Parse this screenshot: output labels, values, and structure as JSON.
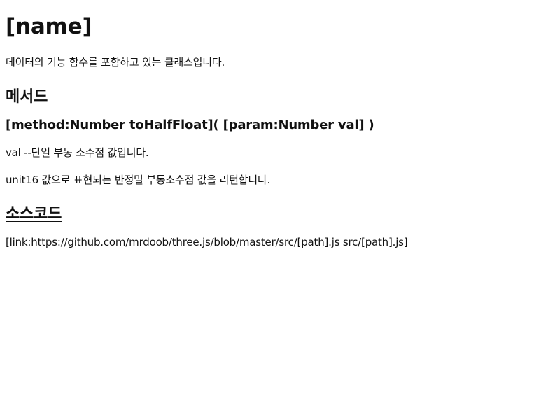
{
  "doc": {
    "title": "[name]",
    "description": "데이터의 기능 함수를 포함하고 있는 클래스입니다.",
    "methods_heading": "메서드",
    "method_signature": "[method:Number toHalfFloat]( [param:Number val] )",
    "param_desc": "val --단일 부동 소수점 값입니다.",
    "return_desc": "unit16 값으로 표현되는 반정밀 부동소수점 값을 리턴합니다.",
    "source_heading": "소스코드",
    "source_link": "[link:https://github.com/mrdoob/three.js/blob/master/src/[path].js src/[path].js]"
  }
}
